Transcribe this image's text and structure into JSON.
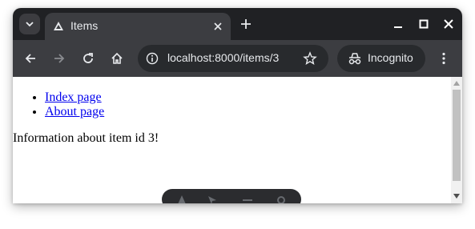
{
  "browser": {
    "tab_title": "Items",
    "url": "localhost:8000/items/3",
    "profile_label": "Incognito"
  },
  "page": {
    "links": [
      {
        "label": "Index page"
      },
      {
        "label": "About page"
      }
    ],
    "info_text": "Information about item id 3!"
  },
  "colors": {
    "titlebar": "#202124",
    "toolbar": "#3c3d41",
    "link": "#0000ee"
  }
}
